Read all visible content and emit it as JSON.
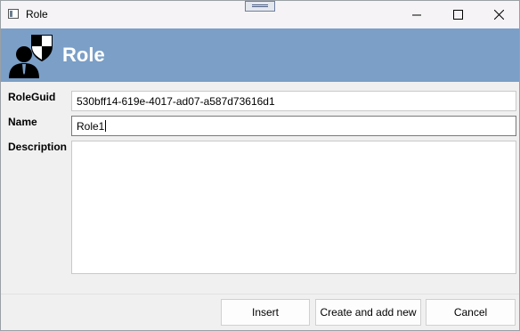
{
  "window": {
    "title": "Role",
    "app_icon": "window-app-icon",
    "controls": [
      "minimize-icon",
      "maximize-icon",
      "close-icon"
    ]
  },
  "banner": {
    "title": "Role",
    "icon": "role-user-shield-icon",
    "background": "#7b9fc7"
  },
  "form": {
    "roleguid_label": "RoleGuid",
    "roleguid_value": "530bff14-619e-4017-ad07-a587d73616d1",
    "name_label": "Name",
    "name_value": "Role1",
    "description_label": "Description",
    "description_value": ""
  },
  "buttons": {
    "insert": "Insert",
    "create_and_add_new": "Create and add new",
    "cancel": "Cancel"
  }
}
